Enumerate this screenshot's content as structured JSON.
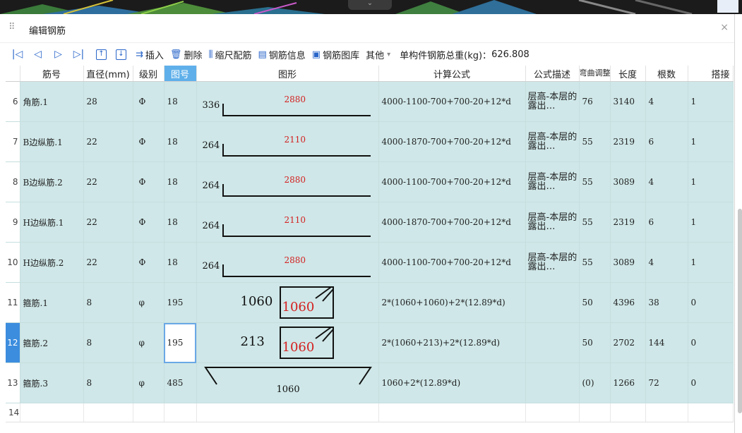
{
  "viewport": {
    "center_tab": "⌄"
  },
  "window": {
    "title": "编辑钢筋",
    "grip_icon": "drag-grip-icon",
    "close_symbol": "×"
  },
  "toolbar": {
    "nav_first": "|◁",
    "nav_prev": "◁",
    "nav_next": "▷",
    "nav_last": "▷|",
    "move_up": "↑",
    "move_down": "↓",
    "insert": "插入",
    "delete": "删除",
    "scale_rebar": "缩尺配筋",
    "rebar_info": "钢筋信息",
    "rebar_library": "钢筋图库",
    "other": "其他",
    "other_caret": "▾",
    "total_weight_label": "单构件钢筋总重(kg)：",
    "total_weight_value": "626.808"
  },
  "columns": [
    "筋号",
    "直径(mm)",
    "级别",
    "图号",
    "图形",
    "计算公式",
    "公式描述",
    "弯曲调整",
    "长度",
    "根数",
    "搭接"
  ],
  "rows": [
    {
      "idx": "6",
      "name": "角筋.1",
      "dia": "28",
      "grade": "Φ",
      "fig": "18",
      "shape": "L",
      "left": "336",
      "red": "2880",
      "formula": "4000-1100-700+700-20+12*d",
      "desc": "层高-本层的露出…",
      "bend": "76",
      "len": "3140",
      "count": "4",
      "lap": "1"
    },
    {
      "idx": "7",
      "name": "B边纵筋.1",
      "dia": "22",
      "grade": "Φ",
      "fig": "18",
      "shape": "L",
      "left": "264",
      "red": "2110",
      "formula": "4000-1870-700+700-20+12*d",
      "desc": "层高-本层的露出…",
      "bend": "55",
      "len": "2319",
      "count": "6",
      "lap": "1"
    },
    {
      "idx": "8",
      "name": "B边纵筋.2",
      "dia": "22",
      "grade": "Φ",
      "fig": "18",
      "shape": "L",
      "left": "264",
      "red": "2880",
      "formula": "4000-1100-700+700-20+12*d",
      "desc": "层高-本层的露出…",
      "bend": "55",
      "len": "3089",
      "count": "4",
      "lap": "1"
    },
    {
      "idx": "9",
      "name": "H边纵筋.1",
      "dia": "22",
      "grade": "Φ",
      "fig": "18",
      "shape": "L",
      "left": "264",
      "red": "2110",
      "formula": "4000-1870-700+700-20+12*d",
      "desc": "层高-本层的露出…",
      "bend": "55",
      "len": "2319",
      "count": "6",
      "lap": "1"
    },
    {
      "idx": "10",
      "name": "H边纵筋.2",
      "dia": "22",
      "grade": "Φ",
      "fig": "18",
      "shape": "L",
      "left": "264",
      "red": "2880",
      "formula": "4000-1100-700+700-20+12*d",
      "desc": "层高-本层的露出…",
      "bend": "55",
      "len": "3089",
      "count": "4",
      "lap": "1"
    },
    {
      "idx": "11",
      "name": "箍筋.1",
      "dia": "8",
      "grade": "φ",
      "fig": "195",
      "shape": "stirrup",
      "left": "1060",
      "red": "1060",
      "formula": "2*(1060+1060)+2*(12.89*d)",
      "desc": "",
      "bend": "50",
      "len": "4396",
      "count": "38",
      "lap": "0"
    },
    {
      "idx": "12",
      "name": "箍筋.2",
      "dia": "8",
      "grade": "φ",
      "fig": "195",
      "shape": "stirrup",
      "left": "213",
      "red": "1060",
      "formula": "2*(1060+213)+2*(12.89*d)",
      "desc": "",
      "bend": "50",
      "len": "2702",
      "count": "144",
      "lap": "0"
    },
    {
      "idx": "13",
      "name": "箍筋.3",
      "dia": "8",
      "grade": "φ",
      "fig": "485",
      "shape": "tie",
      "left": "",
      "red": "1060",
      "formula": "1060+2*(12.89*d)",
      "desc": "",
      "bend": "(0)",
      "len": "1266",
      "count": "72",
      "lap": "0"
    }
  ],
  "empty_row_idx": "14",
  "selected_row": "12",
  "colors": {
    "row_bg": "#cfe7e8",
    "header_highlight": "#5fb0ea",
    "accent": "#2a66c9",
    "dim_red": "#d42020"
  }
}
